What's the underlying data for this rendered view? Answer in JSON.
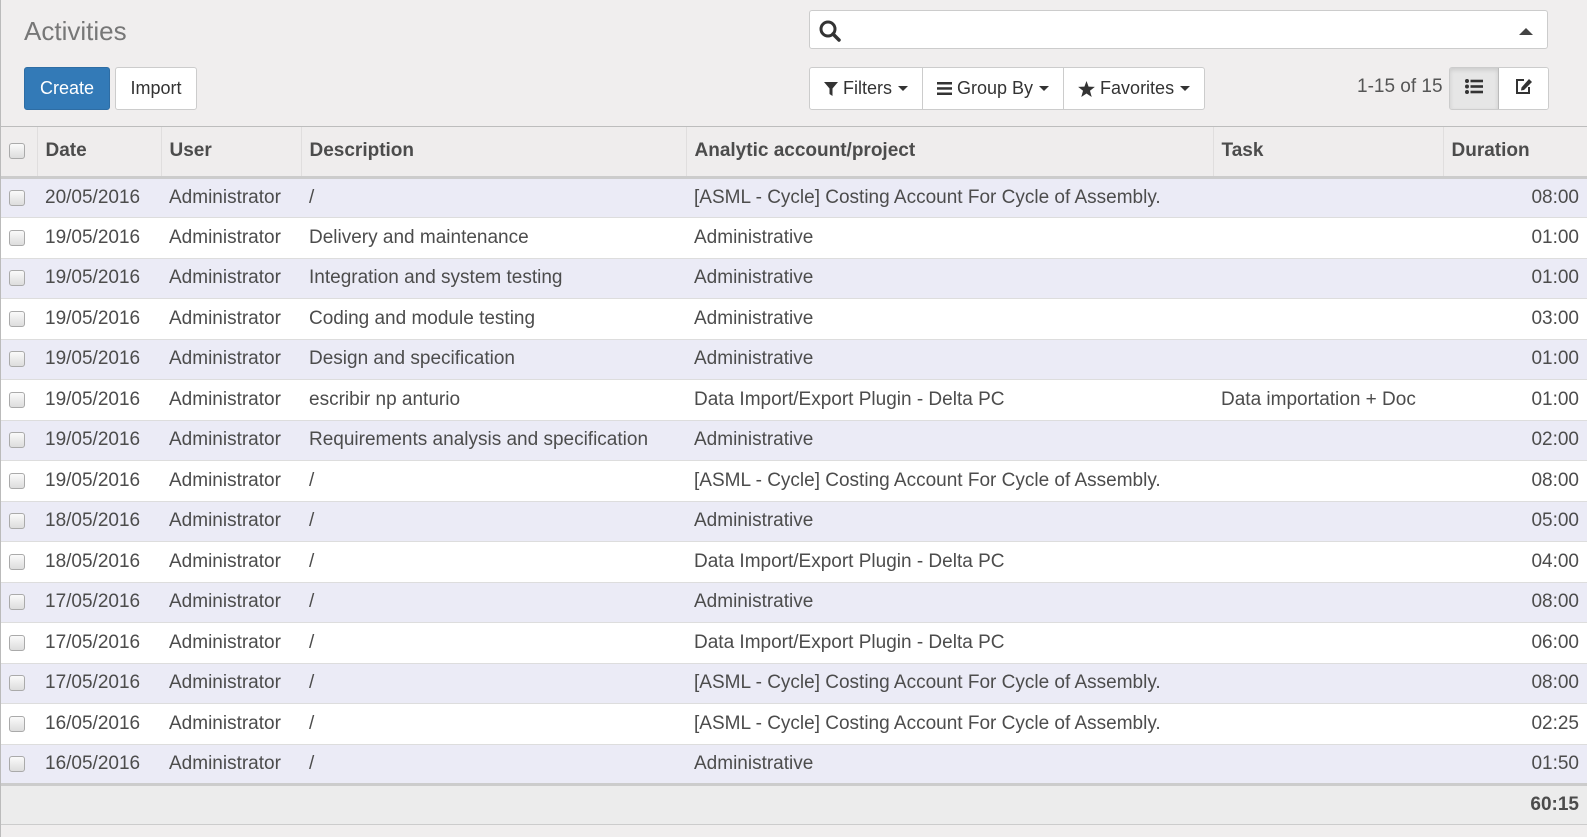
{
  "header": {
    "title": "Activities",
    "create_label": "Create",
    "import_label": "Import"
  },
  "search": {
    "placeholder": "",
    "value": ""
  },
  "searchbar_buttons": {
    "filters_label": "Filters",
    "groupby_label": "Group By",
    "favorites_label": "Favorites"
  },
  "pager": {
    "text": "1-15 of 15"
  },
  "views": {
    "list": "list-view",
    "form": "form-view"
  },
  "table": {
    "columns": [
      "Date",
      "User",
      "Description",
      "Analytic account/project",
      "Task",
      "Duration"
    ],
    "rows": [
      {
        "date": "20/05/2016",
        "user": "Administrator",
        "description": "/",
        "account": "[ASML - Cycle] Costing Account For Cycle of Assembly.",
        "task": "",
        "duration": "08:00"
      },
      {
        "date": "19/05/2016",
        "user": "Administrator",
        "description": "Delivery and maintenance",
        "account": "Administrative",
        "task": "",
        "duration": "01:00"
      },
      {
        "date": "19/05/2016",
        "user": "Administrator",
        "description": "Integration and system testing",
        "account": "Administrative",
        "task": "",
        "duration": "01:00"
      },
      {
        "date": "19/05/2016",
        "user": "Administrator",
        "description": "Coding and module testing",
        "account": "Administrative",
        "task": "",
        "duration": "03:00"
      },
      {
        "date": "19/05/2016",
        "user": "Administrator",
        "description": "Design and specification",
        "account": "Administrative",
        "task": "",
        "duration": "01:00"
      },
      {
        "date": "19/05/2016",
        "user": "Administrator",
        "description": "escribir np anturio",
        "account": "Data Import/Export Plugin - Delta PC",
        "task": "Data importation + Doc",
        "duration": "01:00"
      },
      {
        "date": "19/05/2016",
        "user": "Administrator",
        "description": "Requirements analysis and specification",
        "account": "Administrative",
        "task": "",
        "duration": "02:00"
      },
      {
        "date": "19/05/2016",
        "user": "Administrator",
        "description": "/",
        "account": "[ASML - Cycle] Costing Account For Cycle of Assembly.",
        "task": "",
        "duration": "08:00"
      },
      {
        "date": "18/05/2016",
        "user": "Administrator",
        "description": "/",
        "account": "Administrative",
        "task": "",
        "duration": "05:00"
      },
      {
        "date": "18/05/2016",
        "user": "Administrator",
        "description": "/",
        "account": "Data Import/Export Plugin - Delta PC",
        "task": "",
        "duration": "04:00"
      },
      {
        "date": "17/05/2016",
        "user": "Administrator",
        "description": "/",
        "account": "Administrative",
        "task": "",
        "duration": "08:00"
      },
      {
        "date": "17/05/2016",
        "user": "Administrator",
        "description": "/",
        "account": "Data Import/Export Plugin - Delta PC",
        "task": "",
        "duration": "06:00"
      },
      {
        "date": "17/05/2016",
        "user": "Administrator",
        "description": "/",
        "account": "[ASML - Cycle] Costing Account For Cycle of Assembly.",
        "task": "",
        "duration": "08:00"
      },
      {
        "date": "16/05/2016",
        "user": "Administrator",
        "description": "/",
        "account": "[ASML - Cycle] Costing Account For Cycle of Assembly.",
        "task": "",
        "duration": "02:25"
      },
      {
        "date": "16/05/2016",
        "user": "Administrator",
        "description": "/",
        "account": "Administrative",
        "task": "",
        "duration": "01:50"
      }
    ],
    "total_duration": "60:15"
  }
}
